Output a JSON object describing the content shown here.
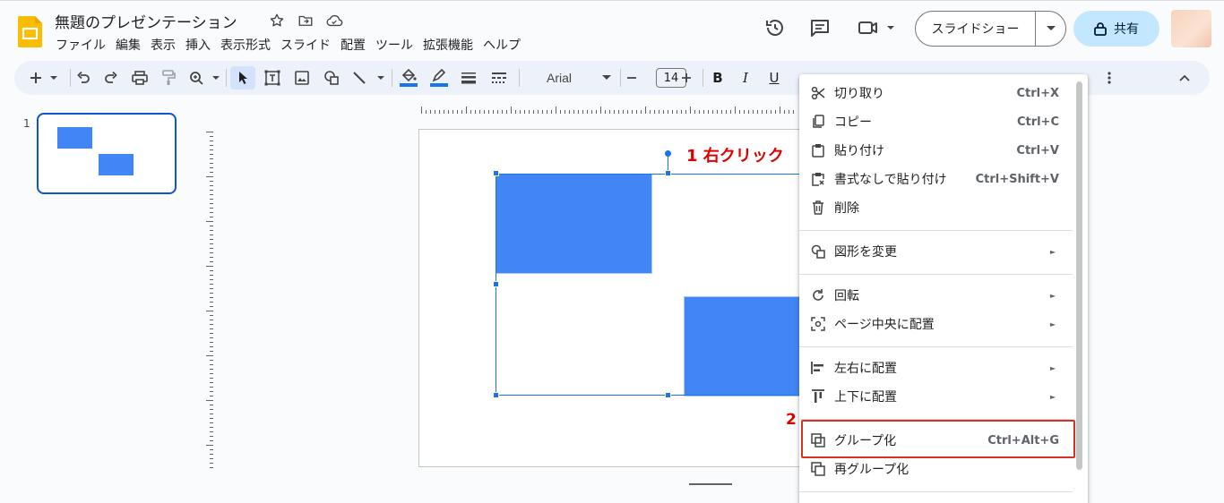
{
  "doc": {
    "title": "無題のプレゼンテーション",
    "logo_icon": "google-slides-logo",
    "title_icons": [
      "star-icon",
      "move-to-folder-icon",
      "cloud-saved-icon"
    ]
  },
  "menubar": {
    "items": [
      "ファイル",
      "編集",
      "表示",
      "挿入",
      "表示形式",
      "スライド",
      "配置",
      "ツール",
      "拡張機能",
      "ヘルプ"
    ]
  },
  "header": {
    "icons": [
      "version-history-icon",
      "comments-icon",
      "meet-video-icon"
    ],
    "slideshow_label": "スライドショー",
    "share_label": "共有"
  },
  "toolbar": {
    "font_name": "Arial",
    "font_size": "14",
    "bold_label": "B",
    "italic_label": "I",
    "underline_label": "U"
  },
  "filmstrip": {
    "slide_number": "1"
  },
  "annotations": {
    "step1": "1 右クリック",
    "step2": "2"
  },
  "context_menu": {
    "items": [
      {
        "label": "切り取り",
        "shortcut": "Ctrl+X",
        "icon": "scissors-icon"
      },
      {
        "label": "コピー",
        "shortcut": "Ctrl+C",
        "icon": "copy-icon"
      },
      {
        "label": "貼り付け",
        "shortcut": "Ctrl+V",
        "icon": "clipboard-icon"
      },
      {
        "label": "書式なしで貼り付け",
        "shortcut": "Ctrl+Shift+V",
        "icon": "paste-plain-icon"
      },
      {
        "label": "削除",
        "shortcut": "",
        "icon": "trash-icon"
      },
      {
        "label": "図形を変更",
        "shortcut": "",
        "icon": "shapes-icon",
        "submenu": true
      },
      {
        "label": "回転",
        "shortcut": "",
        "icon": "rotate-icon",
        "submenu": true
      },
      {
        "label": "ページ中央に配置",
        "shortcut": "",
        "icon": "center-on-page-icon",
        "submenu": true
      },
      {
        "label": "左右に配置",
        "shortcut": "",
        "icon": "align-horizontal-icon",
        "submenu": true
      },
      {
        "label": "上下に配置",
        "shortcut": "",
        "icon": "align-vertical-icon",
        "submenu": true
      },
      {
        "label": "グループ化",
        "shortcut": "Ctrl+Alt+G",
        "icon": "group-icon"
      },
      {
        "label": "再グループ化",
        "shortcut": "",
        "icon": "regroup-icon"
      }
    ]
  },
  "colors": {
    "accent": "#0b57d0",
    "shape_fill": "#4285f4",
    "highlight": "#d93025",
    "annotation_text": "#e00000"
  }
}
